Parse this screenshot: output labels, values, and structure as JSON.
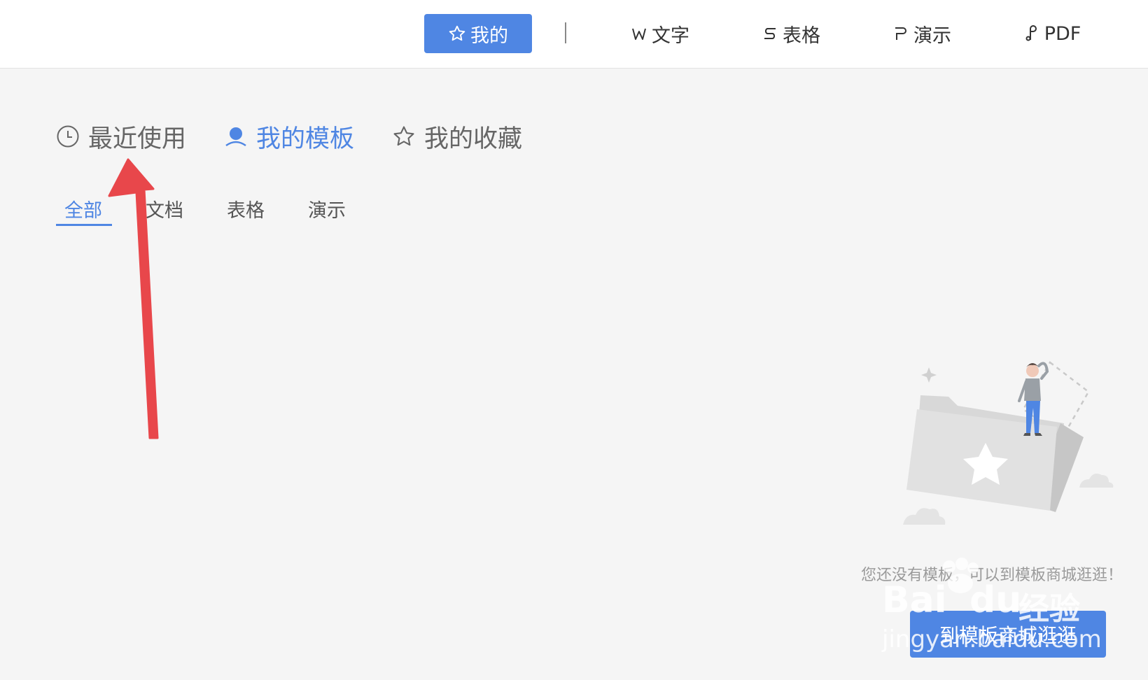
{
  "topbar": {
    "tabs": [
      {
        "label": "我的",
        "icon": "star-outline-icon",
        "active": true
      },
      {
        "label": "文字",
        "icon": "w-letter-icon",
        "active": false
      },
      {
        "label": "表格",
        "icon": "s-letter-icon",
        "active": false
      },
      {
        "label": "演示",
        "icon": "p-letter-icon",
        "active": false
      },
      {
        "label": "PDF",
        "icon": "pdf-letter-icon",
        "active": false
      }
    ]
  },
  "main_tabs": [
    {
      "label": "最近使用",
      "icon": "clock-icon",
      "active": false
    },
    {
      "label": "我的模板",
      "icon": "user-icon",
      "active": true
    },
    {
      "label": "我的收藏",
      "icon": "star-outline-icon",
      "active": false
    }
  ],
  "sub_tabs": [
    {
      "label": "全部",
      "active": true
    },
    {
      "label": "文档",
      "active": false
    },
    {
      "label": "表格",
      "active": false
    },
    {
      "label": "演示",
      "active": false
    }
  ],
  "empty_state": {
    "message": "您还没有模板，可以到模板商城逛逛！",
    "button_label": "到模板商城逛逛"
  },
  "watermark": {
    "brand": "Bai",
    "brand_suffix": "du",
    "cn": "经验",
    "url": "jingyan.baidu.com"
  },
  "colors": {
    "accent": "#4f86e3",
    "annotation_arrow": "#e8474b",
    "background": "#f5f5f5"
  }
}
